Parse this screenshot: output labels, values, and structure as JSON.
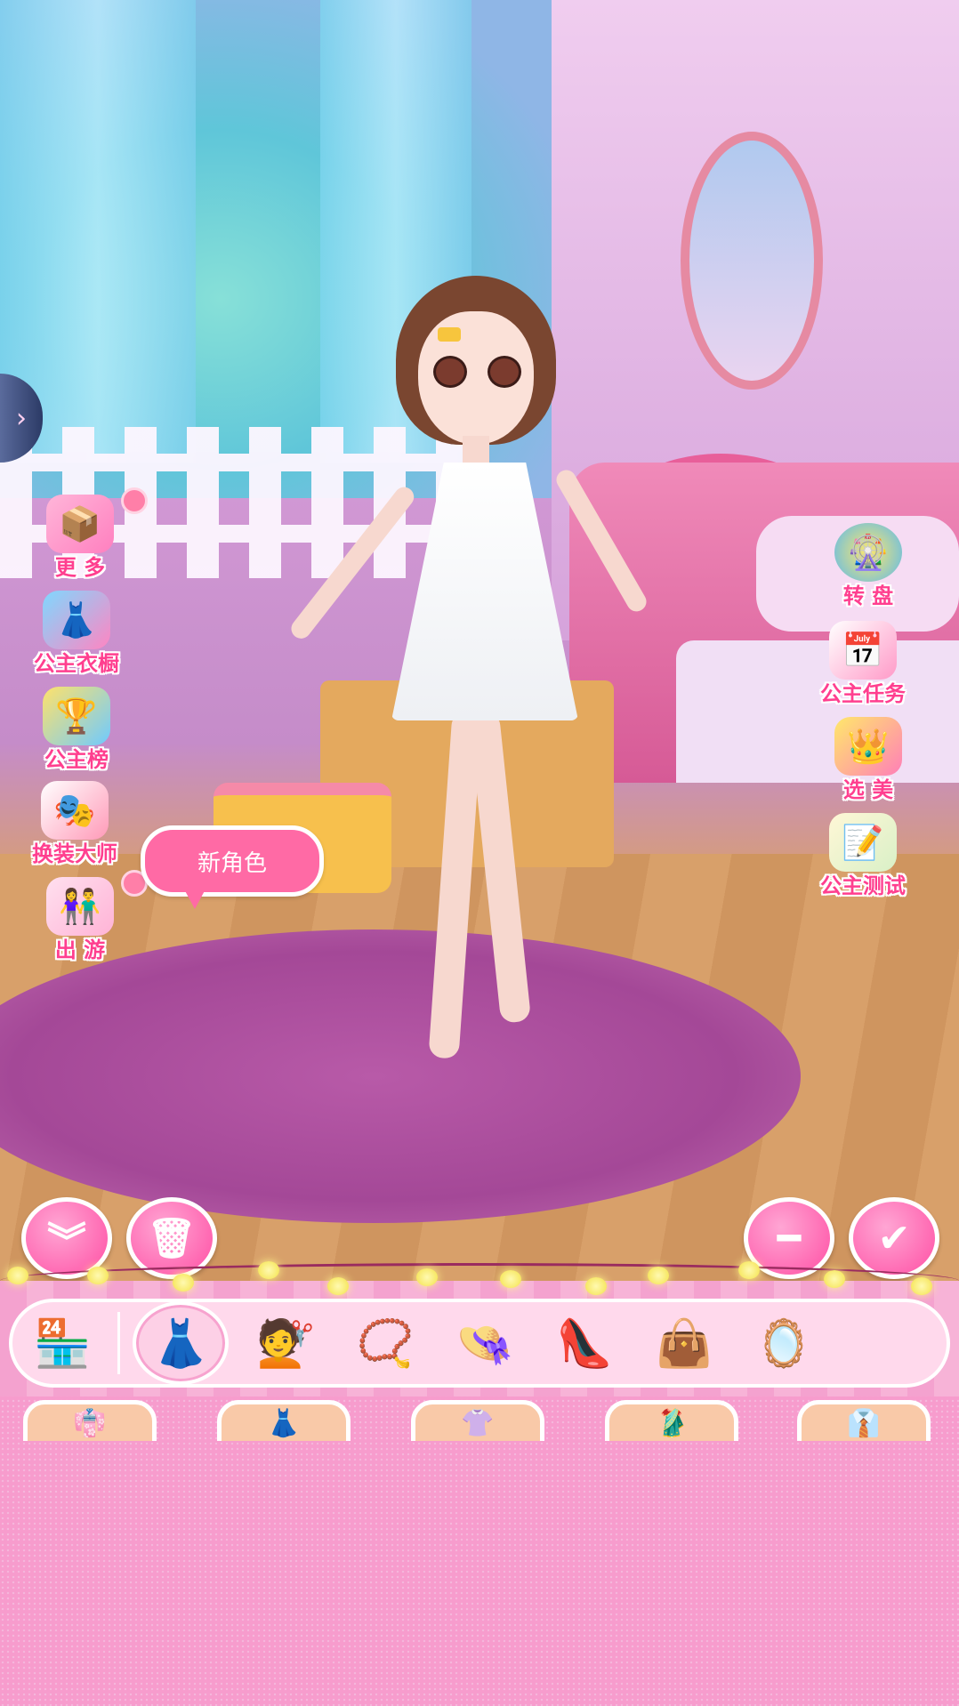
{
  "left_menu": {
    "more": "更 多",
    "wardrobe": "公主衣橱",
    "ranking": "公主榜",
    "stylist": "换装大师",
    "outing": "出 游"
  },
  "right_menu": {
    "wheel": "转 盘",
    "tasks": "公主任务",
    "beauty": "选 美",
    "test": "公主测试"
  },
  "bubble": {
    "text": "新角色"
  },
  "actions": {
    "collapse_icon": "double-chevron-down-icon",
    "delete_icon": "trash-icon",
    "minus_icon": "minus-icon",
    "confirm_icon": "check-icon"
  },
  "tabs": [
    {
      "name": "shop",
      "icon": "🏪"
    },
    {
      "name": "dress",
      "icon": "👗"
    },
    {
      "name": "hair",
      "icon": "💇"
    },
    {
      "name": "necklace",
      "icon": "📿"
    },
    {
      "name": "hat",
      "icon": "👒"
    },
    {
      "name": "shoes",
      "icon": "👠"
    },
    {
      "name": "bag",
      "icon": "👜"
    },
    {
      "name": "makeup",
      "icon": "🪞"
    }
  ],
  "colors": {
    "accent": "#ff3f8f",
    "panel": "#f79ccd",
    "button": "#ff4fa4"
  }
}
